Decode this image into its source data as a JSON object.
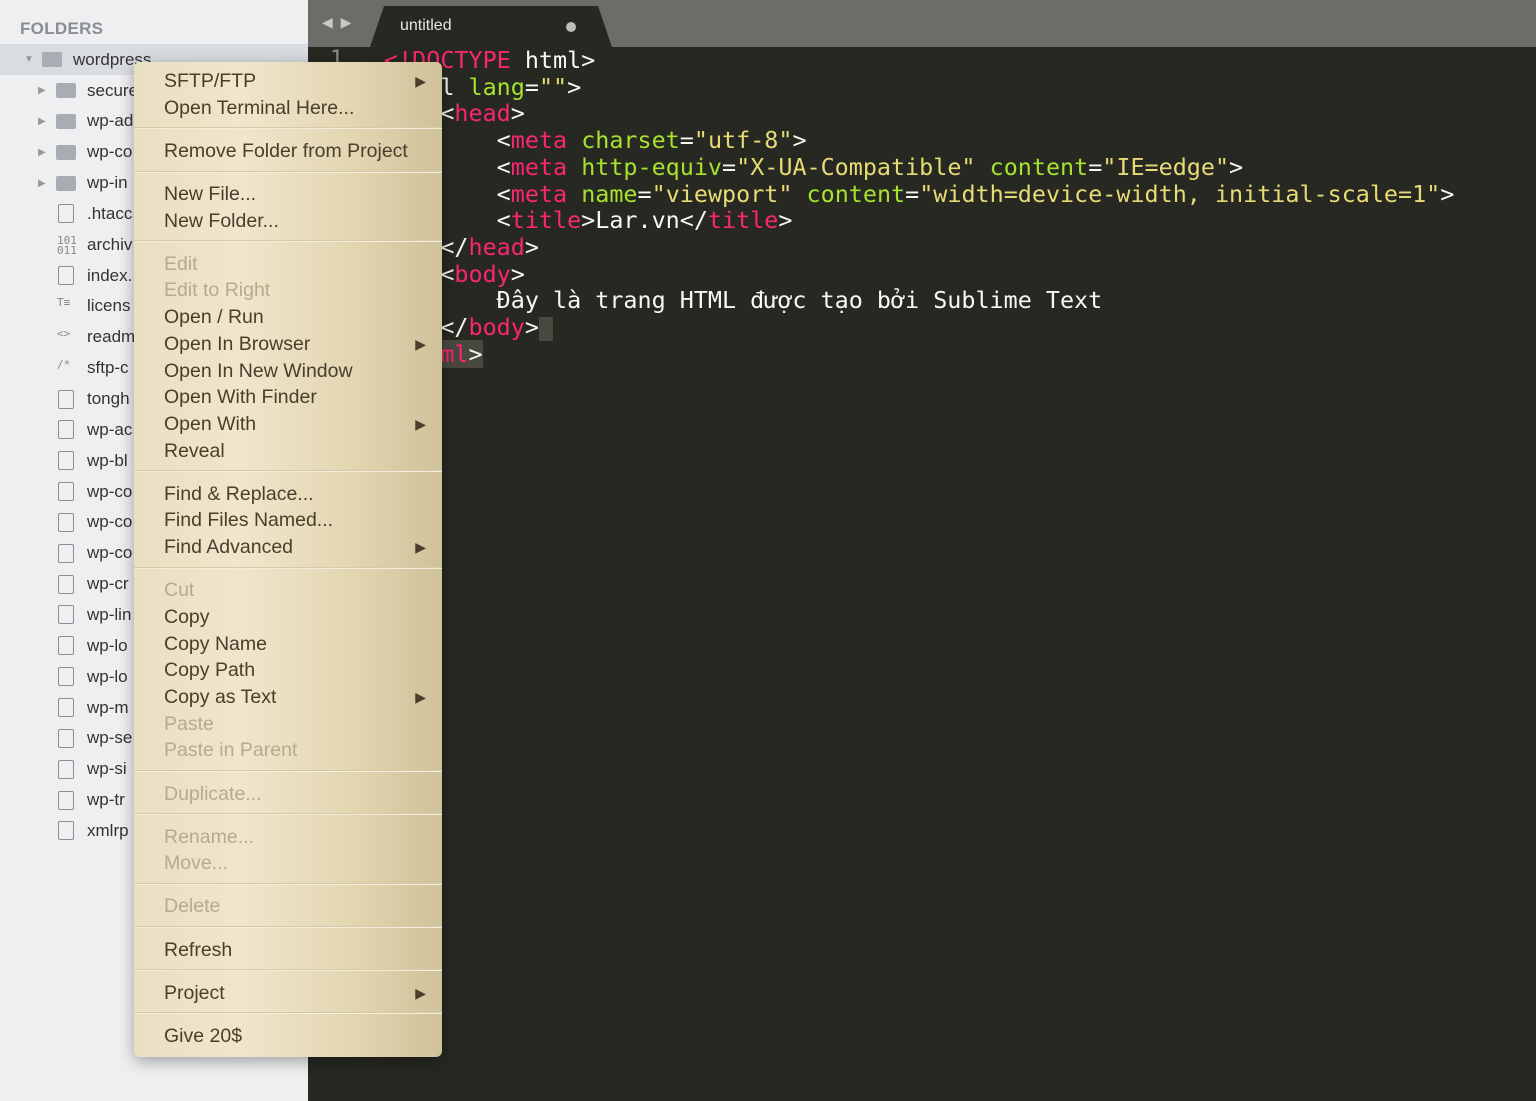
{
  "sidebar": {
    "title": "FOLDERS",
    "root": {
      "label": "wordpress",
      "icon": "folder-open-icon",
      "expanded": true
    },
    "items": [
      {
        "label": "secure",
        "type": "folder"
      },
      {
        "label": "wp-ad",
        "type": "folder"
      },
      {
        "label": "wp-co",
        "type": "folder"
      },
      {
        "label": "wp-in",
        "type": "folder"
      },
      {
        "label": ".htacc",
        "type": "file"
      },
      {
        "label": "archiv",
        "type": "binary"
      },
      {
        "label": "index.",
        "type": "file"
      },
      {
        "label": "licens",
        "type": "text"
      },
      {
        "label": "readm",
        "type": "markup"
      },
      {
        "label": "sftp-c",
        "type": "comment"
      },
      {
        "label": "tongh",
        "type": "file"
      },
      {
        "label": "wp-ac",
        "type": "file"
      },
      {
        "label": "wp-bl",
        "type": "file"
      },
      {
        "label": "wp-co",
        "type": "file"
      },
      {
        "label": "wp-co",
        "type": "file"
      },
      {
        "label": "wp-co",
        "type": "file"
      },
      {
        "label": "wp-cr",
        "type": "file"
      },
      {
        "label": "wp-lin",
        "type": "file"
      },
      {
        "label": "wp-lo",
        "type": "file"
      },
      {
        "label": "wp-lo",
        "type": "file"
      },
      {
        "label": "wp-m",
        "type": "file"
      },
      {
        "label": "wp-se",
        "type": "file"
      },
      {
        "label": "wp-si",
        "type": "file"
      },
      {
        "label": "wp-tr",
        "type": "file"
      },
      {
        "label": "xmlrp",
        "type": "file"
      }
    ]
  },
  "tabbar": {
    "nav": "◀ ▶",
    "tab_title": "untitled",
    "dirty": true
  },
  "editor": {
    "line_number": "1",
    "lines": [
      [
        [
          "t",
          "<"
        ],
        [
          "t",
          "!DOCTYPE"
        ],
        [
          "",
          "",
          " html>"
        ]
      ],
      [
        [
          "",
          "<html "
        ],
        [
          "a",
          "lang"
        ],
        [
          "",
          "="
        ],
        [
          "s",
          "\"\""
        ],
        [
          "",
          ">"
        ]
      ],
      [
        [
          "",
          "    <"
        ],
        [
          "t",
          "head"
        ],
        [
          "",
          ">"
        ]
      ],
      [
        [
          "",
          "        <"
        ],
        [
          "t",
          "meta"
        ],
        [
          "",
          " "
        ],
        [
          "a",
          "charset"
        ],
        [
          "",
          "="
        ],
        [
          "s",
          "\"utf-8\""
        ],
        [
          "",
          ">"
        ]
      ],
      [
        [
          "",
          "        <"
        ],
        [
          "t",
          "meta"
        ],
        [
          "",
          " "
        ],
        [
          "a",
          "http-equiv"
        ],
        [
          "",
          "="
        ],
        [
          "s",
          "\"X-UA-Compatible\""
        ],
        [
          "",
          " "
        ],
        [
          "a",
          "content"
        ],
        [
          "",
          "="
        ],
        [
          "s",
          "\"IE=edge\""
        ],
        [
          "",
          ">"
        ]
      ],
      [
        [
          "",
          "        <"
        ],
        [
          "t",
          "meta"
        ],
        [
          "",
          " "
        ],
        [
          "a",
          "name"
        ],
        [
          "",
          "="
        ],
        [
          "s",
          "\"viewport\""
        ],
        [
          "",
          " "
        ],
        [
          "a",
          "content"
        ],
        [
          "",
          "="
        ],
        [
          "s",
          "\"width=device-width, initial-scale=1\""
        ],
        [
          "",
          ">"
        ]
      ],
      [
        [
          "",
          "        <"
        ],
        [
          "t",
          "title"
        ],
        [
          "",
          ">Lar.vn</"
        ],
        [
          "t",
          "title"
        ],
        [
          "",
          ">"
        ]
      ],
      [
        [
          "",
          ""
        ]
      ],
      [
        [
          "",
          "    </"
        ],
        [
          "t",
          "head"
        ],
        [
          "",
          ">"
        ]
      ],
      [
        [
          "",
          "    <"
        ],
        [
          "t",
          "body"
        ],
        [
          "",
          ">"
        ]
      ],
      [
        [
          "",
          "        Đây là trang HTML được tạo bởi Sublime Text"
        ]
      ],
      [
        [
          "",
          "    </"
        ],
        [
          "t",
          "body"
        ],
        [
          "",
          ">"
        ]
      ],
      [
        [
          "",
          "</ht"
        ],
        [
          "t",
          "ml"
        ],
        [
          "",
          ">"
        ]
      ]
    ]
  },
  "menu": {
    "groups": [
      [
        {
          "label": "SFTP/FTP",
          "submenu": true
        },
        {
          "label": "Open Terminal Here..."
        }
      ],
      [
        {
          "label": "Remove Folder from Project"
        }
      ],
      [
        {
          "label": "New File..."
        },
        {
          "label": "New Folder..."
        }
      ],
      [
        {
          "label": "Edit",
          "disabled": true
        },
        {
          "label": "Edit to Right",
          "disabled": true
        },
        {
          "label": "Open / Run"
        },
        {
          "label": "Open In Browser",
          "submenu": true
        },
        {
          "label": "Open In New Window"
        },
        {
          "label": "Open With Finder"
        },
        {
          "label": "Open With",
          "submenu": true
        },
        {
          "label": "Reveal"
        }
      ],
      [
        {
          "label": "Find & Replace..."
        },
        {
          "label": "Find Files Named..."
        },
        {
          "label": "Find Advanced",
          "submenu": true
        }
      ],
      [
        {
          "label": "Cut",
          "disabled": true
        },
        {
          "label": "Copy"
        },
        {
          "label": "Copy Name"
        },
        {
          "label": "Copy Path"
        },
        {
          "label": "Copy as Text",
          "submenu": true
        },
        {
          "label": "Paste",
          "disabled": true
        },
        {
          "label": "Paste in Parent",
          "disabled": true
        }
      ],
      [
        {
          "label": "Duplicate...",
          "disabled": true
        }
      ],
      [
        {
          "label": "Rename...",
          "disabled": true
        },
        {
          "label": "Move...",
          "disabled": true
        }
      ],
      [
        {
          "label": "Delete",
          "disabled": true
        }
      ],
      [
        {
          "label": "Refresh"
        }
      ],
      [
        {
          "label": "Project",
          "submenu": true
        }
      ],
      [
        {
          "label": "Give 20$"
        }
      ]
    ],
    "submenu_glyph": "▶"
  },
  "colors": {
    "tag": "#f92672",
    "attr": "#a6e22e",
    "string": "#e6db74",
    "editor_bg": "#272822",
    "sidebar_bg": "#eeeff1"
  }
}
